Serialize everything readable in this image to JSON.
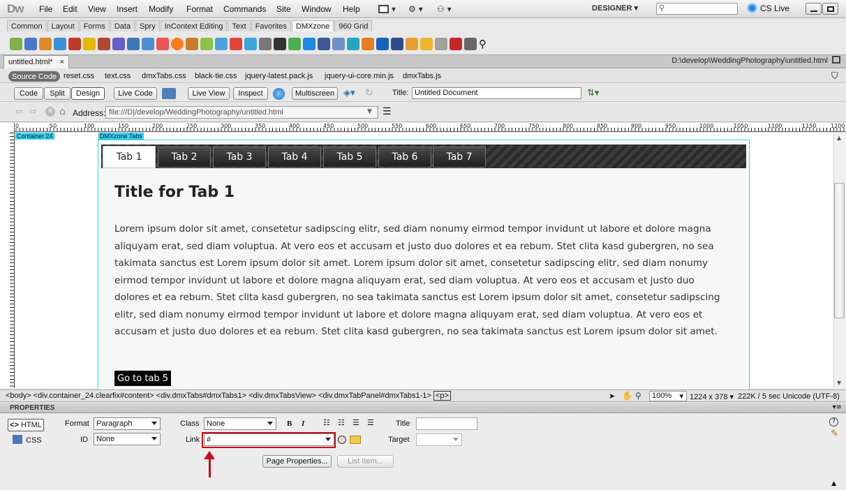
{
  "app": {
    "logo": "Dw",
    "workspace": "DESIGNER",
    "cs_live": "CS Live"
  },
  "menu": [
    "File",
    "Edit",
    "View",
    "Insert",
    "Modify",
    "Format",
    "Commands",
    "Site",
    "Window",
    "Help"
  ],
  "insert_tabs": [
    "Common",
    "Layout",
    "Forms",
    "Data",
    "Spry",
    "InContext Editing",
    "Text",
    "Favorites",
    "DMXzone",
    "960 Grid"
  ],
  "insert_active": "DMXzone",
  "document": {
    "tab_label": "untitled.html*",
    "close": "×",
    "path": "D:\\develop\\WeddingPhotography\\untitled.html"
  },
  "related_files": {
    "source_code": "Source Code",
    "files": [
      "reset.css",
      "text.css",
      "dmxTabs.css",
      "black-tie.css",
      "jquery-latest.pack.js",
      "jquery-ui-core.min.js",
      "dmxTabs.js"
    ]
  },
  "doc_toolbar": {
    "code": "Code",
    "split": "Split",
    "design": "Design",
    "live_code": "Live Code",
    "live_view": "Live View",
    "inspect": "Inspect",
    "multiscreen": "Multiscreen",
    "title_label": "Title:",
    "title_value": "Untitled Document"
  },
  "address": {
    "label": "Address:",
    "value": "file:///D|/develop/WeddingPhotography/untitled.html"
  },
  "ruler_labels": [
    "0",
    "50",
    "100",
    "150",
    "200",
    "250",
    "300",
    "350",
    "400",
    "450",
    "500",
    "550",
    "600",
    "650",
    "700",
    "750",
    "800",
    "850",
    "900",
    "950",
    "1000",
    "1050",
    "1100",
    "1150",
    "1200"
  ],
  "design": {
    "container_label": "Container 24",
    "tabs_label": "DMXzone Tabs",
    "tabs": [
      "Tab 1",
      "Tab 2",
      "Tab 3",
      "Tab 4",
      "Tab 5",
      "Tab 6",
      "Tab 7"
    ],
    "panel_title": "Title for Tab 1",
    "panel_text": "Lorem ipsum dolor sit amet, consetetur sadipscing elitr, sed diam nonumy eirmod tempor invidunt ut labore et dolore magna aliquyam erat, sed diam voluptua. At vero eos et accusam et justo duo dolores et ea rebum. Stet clita kasd gubergren, no sea takimata sanctus est Lorem ipsum dolor sit amet. Lorem ipsum dolor sit amet, consetetur sadipscing elitr, sed diam nonumy eirmod tempor invidunt ut labore et dolore magna aliquyam erat, sed diam voluptua. At vero eos et accusam et justo duo dolores et ea rebum. Stet clita kasd gubergren, no sea takimata sanctus est Lorem ipsum dolor sit amet, consetetur sadipscing elitr, sed diam nonumy eirmod tempor invidunt ut labore et dolore magna aliquyam erat, sed diam voluptua. At vero eos et accusam et justo duo dolores et ea rebum. Stet clita kasd gubergren, no sea takimata sanctus est Lorem ipsum dolor sit amet.",
    "go_button": "Go to tab 5"
  },
  "status": {
    "tag_path": "<body> <div.container_24.clearfix#content> <div.dmxTabs#dmxTabs1> <div.dmxTabsView> <div.dmxTabPanel#dmxTabs1-1>",
    "current_tag": "<p>",
    "zoom": "100%",
    "dimensions": "1224 x 378",
    "size_time": "222K / 5 sec",
    "encoding": "Unicode (UTF-8)"
  },
  "properties": {
    "title": "PROPERTIES",
    "html": "HTML",
    "css": "CSS",
    "format_label": "Format",
    "format_value": "Paragraph",
    "id_label": "ID",
    "id_value": "None",
    "class_label": "Class",
    "class_value": "None",
    "link_label": "Link",
    "link_value": "#",
    "title_label": "Title",
    "target_label": "Target",
    "page_properties": "Page Properties...",
    "list_item": "List Item..."
  },
  "colors": {
    "highlight": "#c0101a",
    "guide": "#3ad0f2",
    "tab_dark": "#2a2a2a"
  }
}
